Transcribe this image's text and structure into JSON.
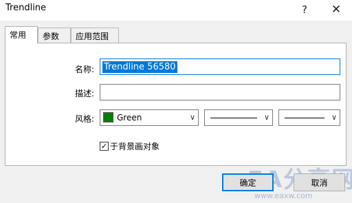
{
  "window": {
    "title": "Trendline",
    "help_icon": "?",
    "close_icon": "✕"
  },
  "tabs": [
    {
      "label": "常用",
      "active": true
    },
    {
      "label": "参数",
      "active": false
    },
    {
      "label": "应用范围",
      "active": false
    }
  ],
  "form": {
    "name_label": "名称:",
    "name_value": "Trendline 56580",
    "description_label": "描述:",
    "description_value": "",
    "style_label": "风格:",
    "color_value": "Green",
    "color_hex": "#008000",
    "background_checkbox_label": "于背景画对象",
    "background_checked": true
  },
  "buttons": {
    "ok_label": "确定",
    "cancel_label": "取消"
  },
  "watermark": {
    "brand": "EA分享网",
    "url": "www.eaxw.com"
  },
  "colors": {
    "accent": "#0078d7",
    "dialog_bg": "#f0f0f0"
  }
}
